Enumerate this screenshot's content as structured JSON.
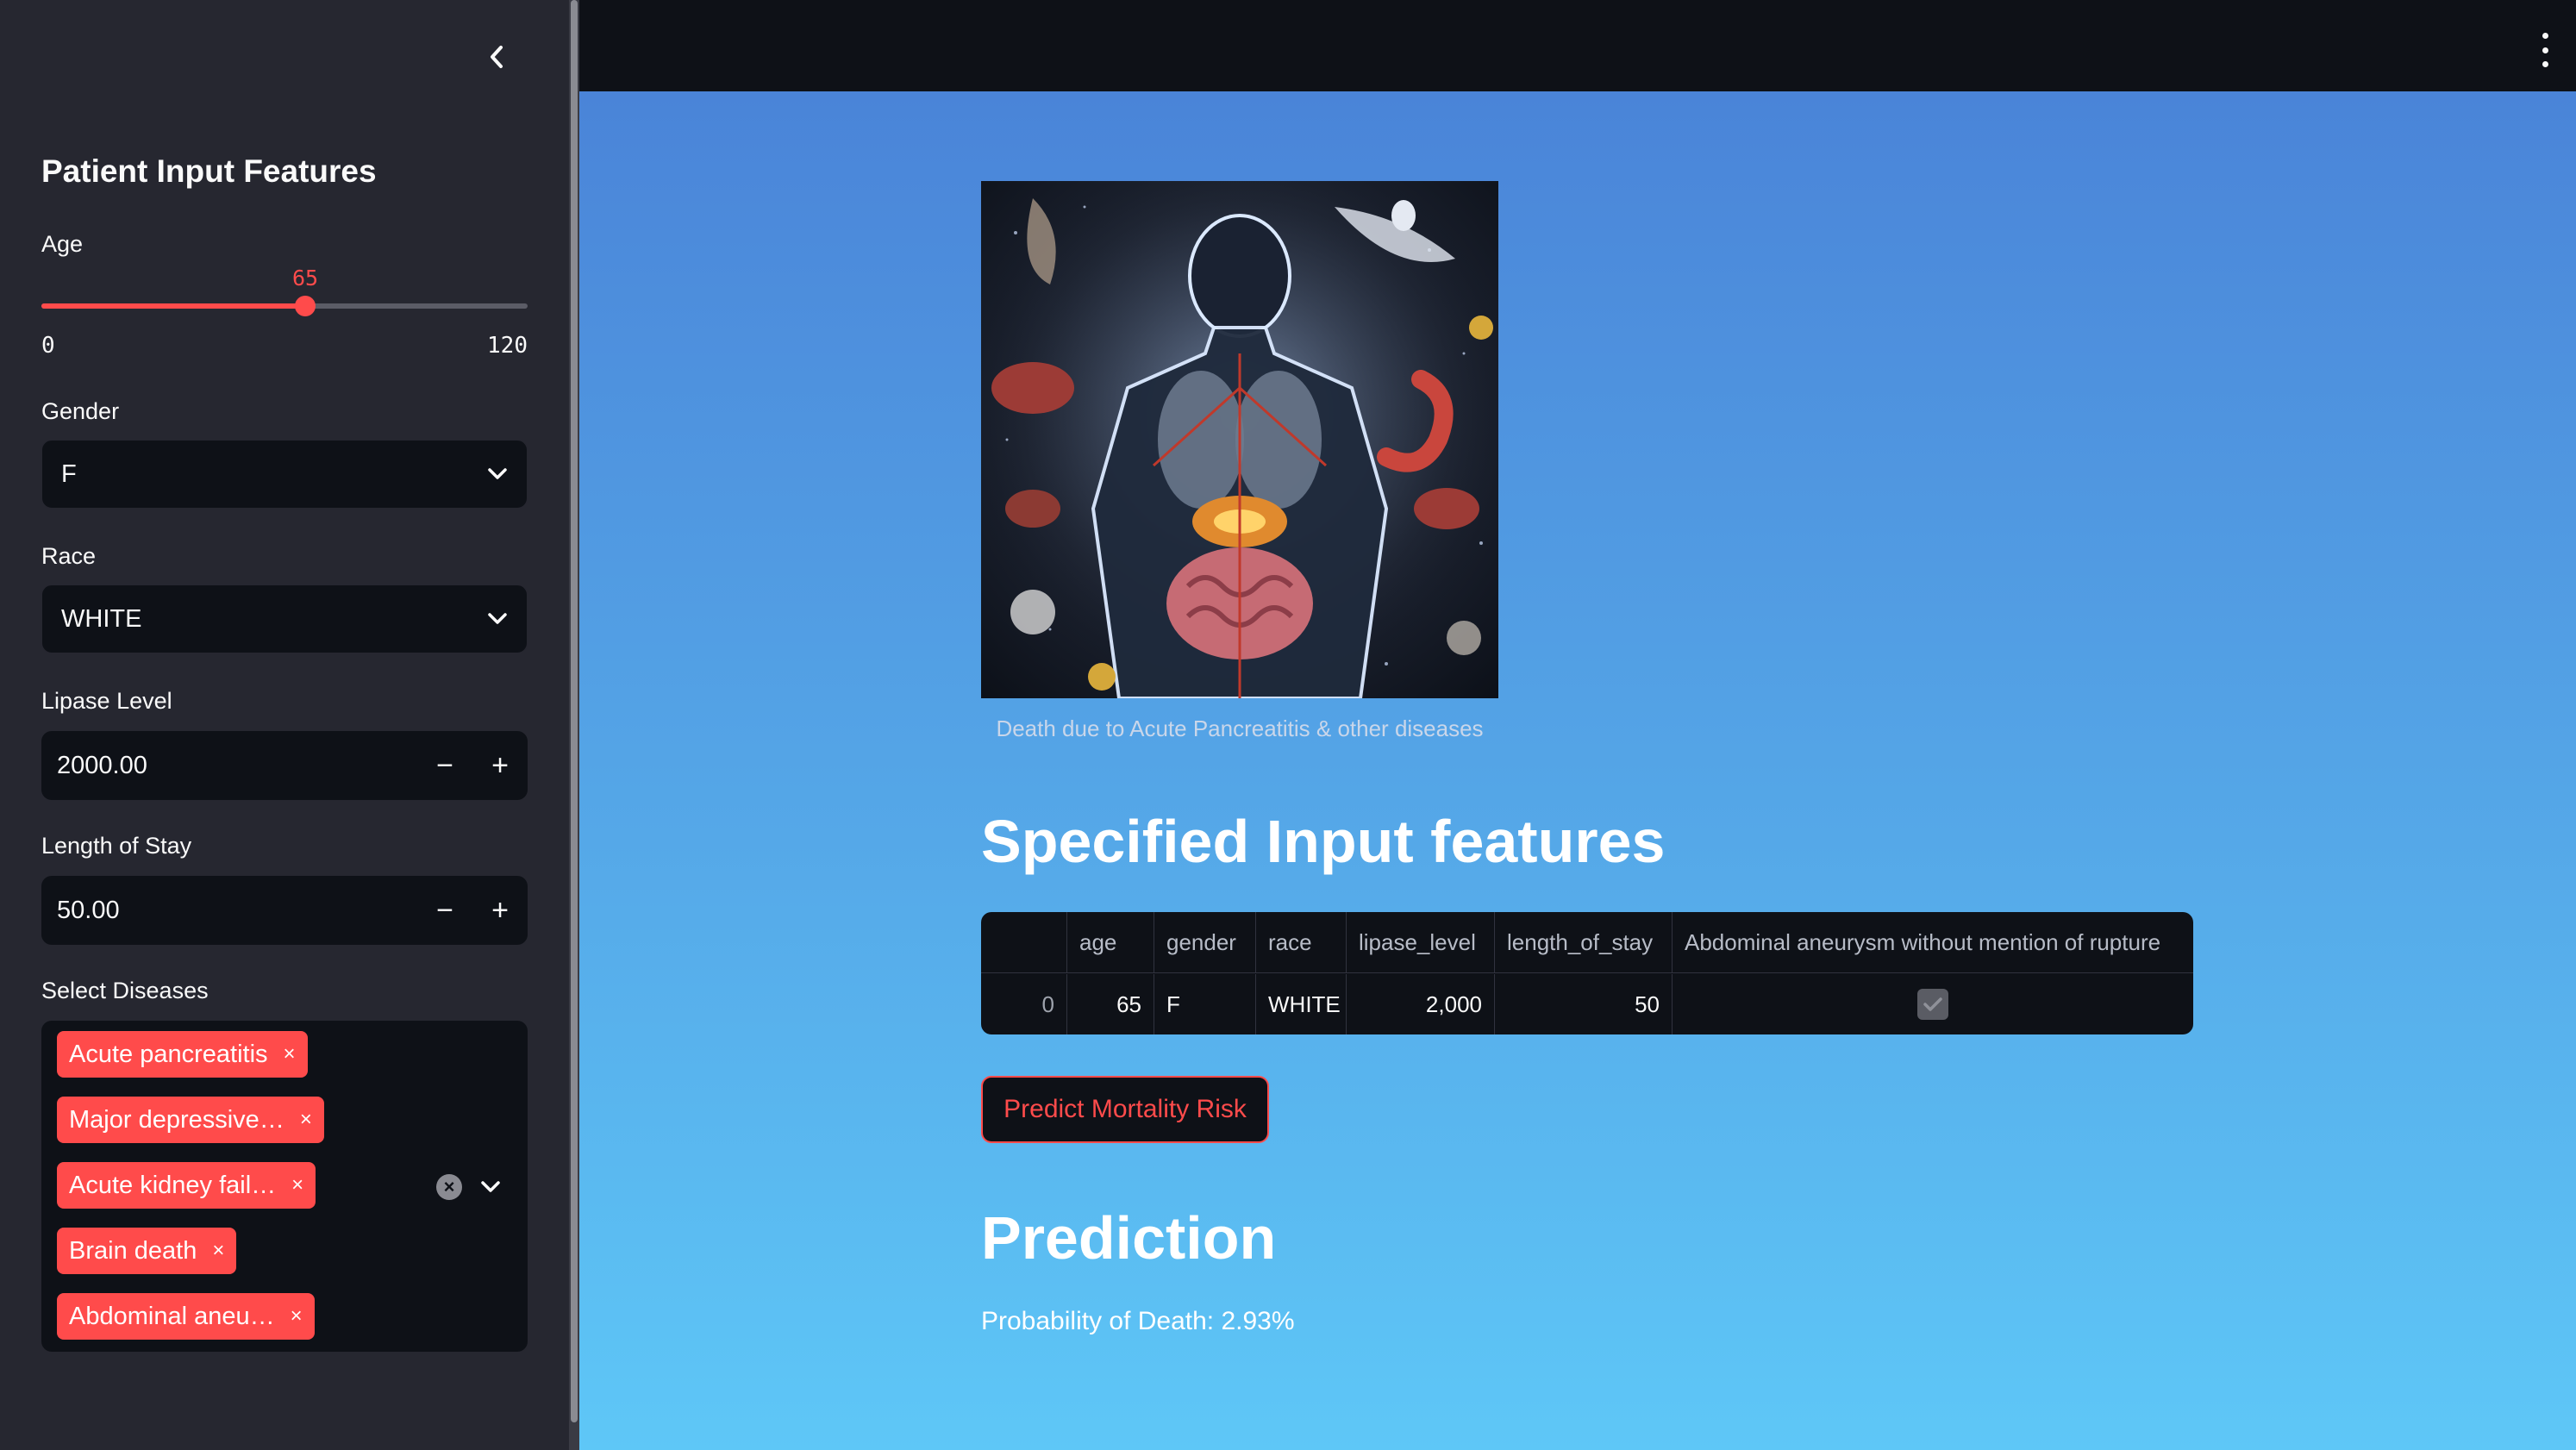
{
  "sidebar": {
    "title": "Patient Input Features",
    "age": {
      "label": "Age",
      "value": "65",
      "min": "0",
      "max": "120",
      "fraction": 0.5417
    },
    "gender": {
      "label": "Gender",
      "value": "F"
    },
    "race": {
      "label": "Race",
      "value": "WHITE"
    },
    "lipase": {
      "label": "Lipase Level",
      "value": "2000.00",
      "minus": "−",
      "plus": "+"
    },
    "stay": {
      "label": "Length of Stay",
      "value": "50.00",
      "minus": "−",
      "plus": "+"
    },
    "diseases": {
      "label": "Select Diseases",
      "tags": [
        "Acute pancreatitis",
        "Major depressive…",
        "Acute kidney fail…",
        "Brain death",
        "Abdominal aneu…"
      ],
      "remove_glyph": "×",
      "clear_glyph": "×"
    }
  },
  "main": {
    "image_caption": "Death due to Acute Pancreatitis & other diseases",
    "input_heading": "Specified Input features",
    "table": {
      "columns": [
        "",
        "age",
        "gender",
        "race",
        "lipase_level",
        "length_of_stay",
        "Abdominal aneurysm without mention of rupture"
      ],
      "row": [
        "0",
        "65",
        "F",
        "WHITE",
        "2,000",
        "50",
        true
      ]
    },
    "predict_button": "Predict Mortality Risk",
    "prediction_heading": "Prediction",
    "probability": "Probability of Death: 2.93%"
  },
  "colors": {
    "accent": "#ff4b4b",
    "sidebar_bg": "#262730",
    "input_bg": "#0e1117",
    "topbar_bg": "#0e1117"
  },
  "icons": {
    "collapse": "chevron-left-icon",
    "menu": "kebab-menu-icon",
    "dropdown": "chevron-down-icon",
    "checkbox": "check-icon"
  }
}
